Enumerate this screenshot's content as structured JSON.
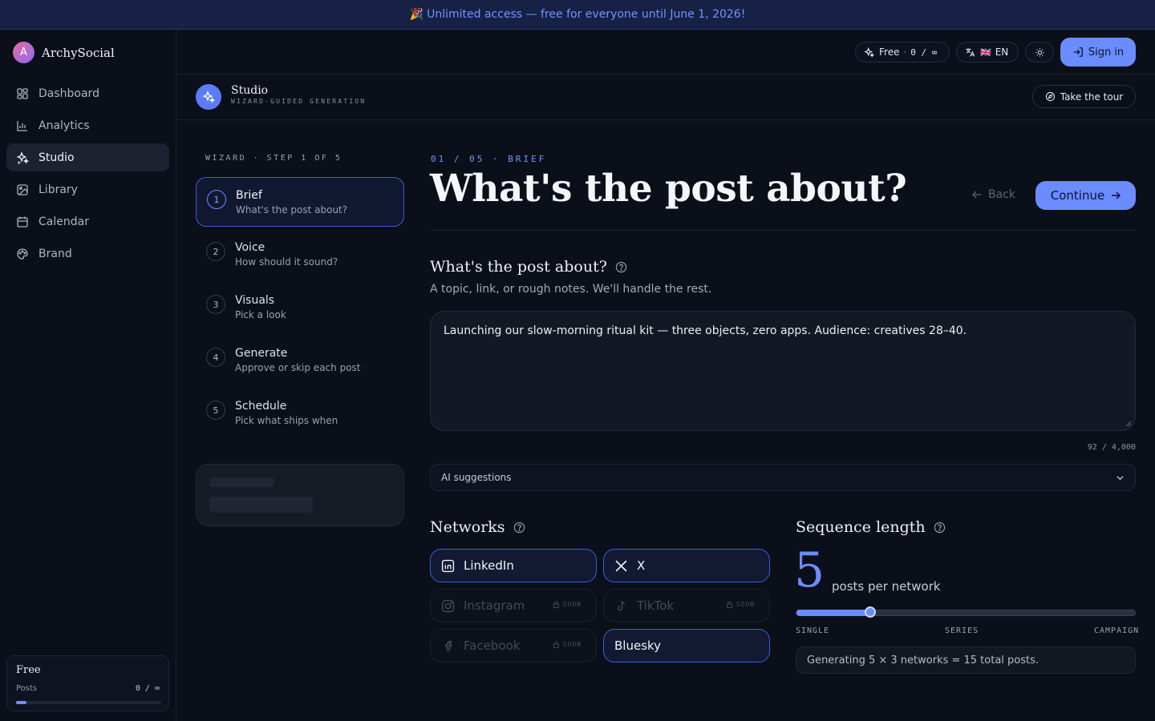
{
  "banner": {
    "emoji": "🎉",
    "text": "Unlimited access — free for everyone until June 1, 2026!"
  },
  "brand": {
    "initial": "A",
    "name": "ArchySocial"
  },
  "nav": [
    {
      "label": "Dashboard",
      "icon": "dashboard-icon"
    },
    {
      "label": "Analytics",
      "icon": "chart-icon"
    },
    {
      "label": "Studio",
      "icon": "sparkles-icon",
      "active": true
    },
    {
      "label": "Library",
      "icon": "image-icon"
    },
    {
      "label": "Calendar",
      "icon": "calendar-icon"
    },
    {
      "label": "Brand",
      "icon": "palette-icon"
    }
  ],
  "plan_card": {
    "name": "Free",
    "label": "Posts",
    "count": "0 / ∞",
    "usage_fraction": 0.07
  },
  "topbar": {
    "plan_pill": {
      "name": "Free",
      "sep": "·",
      "count": "0 / ∞"
    },
    "lang_pill": {
      "flag": "🇬🇧",
      "code": "EN"
    },
    "signin_label": "Sign in"
  },
  "studio": {
    "title": "Studio",
    "subtitle": "WIZARD-GUIDED GENERATION",
    "tour_label": "Take the tour"
  },
  "wizard": {
    "label": "WIZARD · STEP 1 OF 5",
    "steps": [
      {
        "num": "1",
        "title": "Brief",
        "sub": "What's the post about?"
      },
      {
        "num": "2",
        "title": "Voice",
        "sub": "How should it sound?"
      },
      {
        "num": "3",
        "title": "Visuals",
        "sub": "Pick a look"
      },
      {
        "num": "4",
        "title": "Generate",
        "sub": "Approve or skip each post"
      },
      {
        "num": "5",
        "title": "Schedule",
        "sub": "Pick what ships when"
      }
    ]
  },
  "main": {
    "crumb": "01 / 05 · BRIEF",
    "title": "What's the post about?",
    "back_label": "Back",
    "continue_label": "Continue"
  },
  "brief": {
    "title": "What's the post about?",
    "desc": "A topic, link, or rough notes. We'll handle the rest.",
    "value": "Launching our slow-morning ritual kit — three objects, zero apps. Audience: creatives 28–40.",
    "char_count": "92 / 4,000"
  },
  "ai_suggestions": {
    "label": "AI suggestions"
  },
  "networks": {
    "title": "Networks",
    "items": [
      {
        "label": "LinkedIn",
        "icon": "linkedin-icon",
        "selected": true
      },
      {
        "label": "X",
        "icon": "x-icon",
        "selected": true
      },
      {
        "label": "Instagram",
        "icon": "instagram-icon",
        "soon": "SOON"
      },
      {
        "label": "TikTok",
        "icon": "tiktok-icon",
        "soon": "SOON"
      },
      {
        "label": "Facebook",
        "icon": "facebook-icon",
        "soon": "SOON"
      },
      {
        "label": "Bluesky",
        "icon": "",
        "selected": true
      }
    ]
  },
  "sequence": {
    "title": "Sequence length",
    "value": "5",
    "unit_label": "posts per network",
    "slider_fraction": 0.22,
    "ticks": [
      "SINGLE",
      "SERIES",
      "CAMPAIGN"
    ],
    "summary": "Generating 5 × 3 networks = 15 total posts."
  },
  "colors": {
    "accent": "#6b8cff",
    "background": "#0b0f19",
    "banner_text": "#6f96ff"
  }
}
